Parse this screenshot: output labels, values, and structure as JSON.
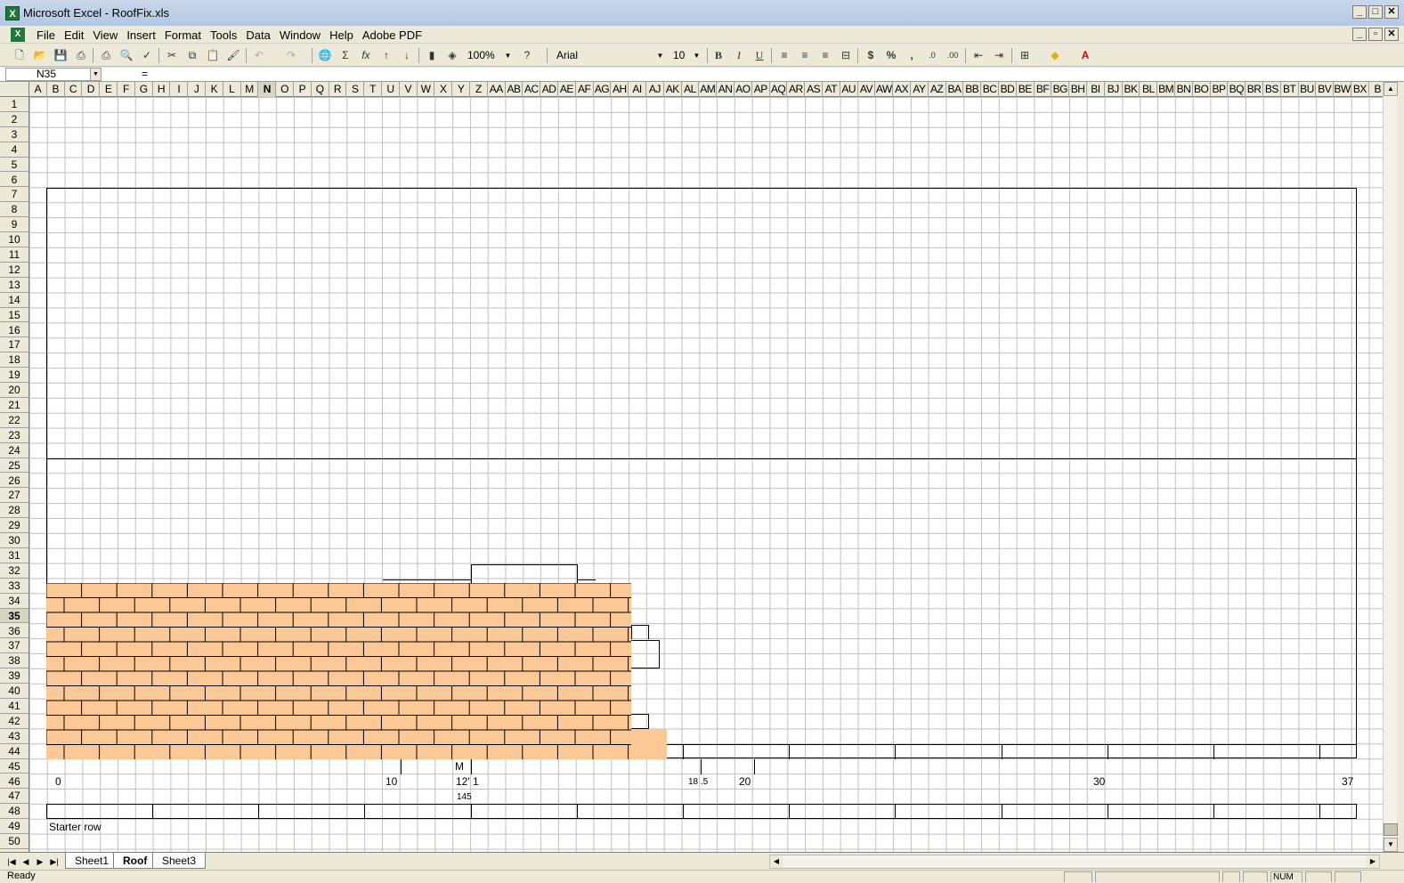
{
  "window": {
    "title": "Microsoft Excel - RoofFix.xls",
    "controls": [
      "_",
      "□",
      "✕"
    ],
    "doc_controls": [
      "_",
      "▫",
      "✕"
    ]
  },
  "menu": [
    "File",
    "Edit",
    "View",
    "Insert",
    "Format",
    "Tools",
    "Data",
    "Window",
    "Help",
    "Adobe PDF"
  ],
  "toolbar": {
    "zoom": "100%",
    "font": "Arial",
    "font_size": "10",
    "bold": "B",
    "italic": "I",
    "underline": "U",
    "currency": "$",
    "percent": "%",
    "comma": ",",
    "autosum": "Σ",
    "function": "fx"
  },
  "formula_bar": {
    "name_box": "N35",
    "equals": "="
  },
  "columns": [
    "A",
    "B",
    "C",
    "D",
    "E",
    "F",
    "G",
    "H",
    "I",
    "J",
    "K",
    "L",
    "M",
    "N",
    "O",
    "P",
    "Q",
    "R",
    "S",
    "T",
    "U",
    "V",
    "W",
    "X",
    "Y",
    "Z",
    "AA",
    "AB",
    "AC",
    "AD",
    "AE",
    "AF",
    "AG",
    "AH",
    "AI",
    "AJ",
    "AK",
    "AL",
    "AM",
    "AN",
    "AO",
    "AP",
    "AQ",
    "AR",
    "AS",
    "AT",
    "AU",
    "AV",
    "AW",
    "AX",
    "AY",
    "AZ",
    "BA",
    "BB",
    "BC",
    "BD",
    "BE",
    "BF",
    "BG",
    "BH",
    "BI",
    "BJ",
    "BK",
    "BL",
    "BM",
    "BN",
    "BO",
    "BP",
    "BQ",
    "BR",
    "BS",
    "BT",
    "BU",
    "BV",
    "BW",
    "BX",
    "B"
  ],
  "selected_column": "N",
  "selected_row": "35",
  "rows": [
    "1",
    "2",
    "3",
    "4",
    "5",
    "6",
    "7",
    "8",
    "9",
    "10",
    "11",
    "12",
    "13",
    "14",
    "15",
    "16",
    "17",
    "18",
    "19",
    "20",
    "21",
    "22",
    "23",
    "24",
    "25",
    "26",
    "27",
    "28",
    "29",
    "30",
    "31",
    "32",
    "33",
    "34",
    "35",
    "36",
    "37",
    "38",
    "39",
    "40",
    "41",
    "42",
    "43",
    "44",
    "45",
    "46",
    "47",
    "48",
    "49",
    "50"
  ],
  "cell_text": {
    "m_marker": "M",
    "scale_0": "0",
    "scale_10": "10",
    "scale_12_1": "12' 1",
    "scale_18_5": "18 .5",
    "scale_20": "20",
    "scale_30": "30",
    "scale_37": "37",
    "val_145": "145",
    "starter_row": "Starter row"
  },
  "colors": {
    "brick_fill": "#fcc895",
    "gridline": "#c0c0c0"
  },
  "sheets": [
    "Sheet1",
    "Roof",
    "Sheet3"
  ],
  "active_sheet": "Roof",
  "status": {
    "text": "Ready",
    "num": "NUM"
  }
}
